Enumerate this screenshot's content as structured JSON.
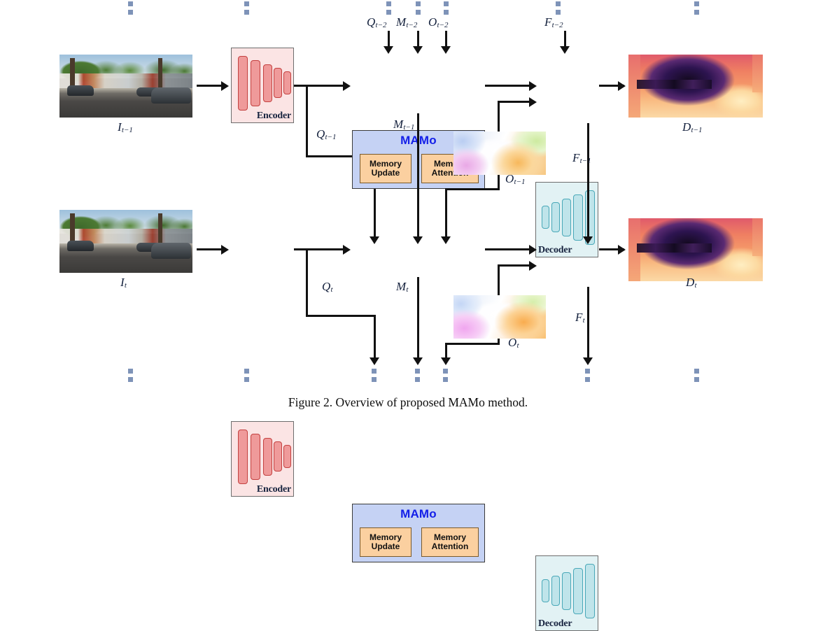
{
  "figure": {
    "caption": "Figure 2. Overview of proposed MAMo method."
  },
  "blocks": {
    "encoder_label": "Encoder",
    "decoder_label": "Decoder",
    "mamo_title": "MAMo",
    "memory_update_line1": "Memory",
    "memory_update_line2": "Update",
    "memory_attention_line1": "Memory",
    "memory_attention_line2": "Attention"
  },
  "labels": {
    "top_q": "Q",
    "top_q_sub": "t−2",
    "top_m": "M",
    "top_m_sub": "t−2",
    "top_o": "O",
    "top_o_sub": "t−2",
    "top_f": "F",
    "top_f_sub": "t−2",
    "img_prev": "I",
    "img_prev_sub": "t−1",
    "img_cur": "I",
    "img_cur_sub": "t",
    "depth_prev": "D",
    "depth_prev_sub": "t−1",
    "depth_cur": "D",
    "depth_cur_sub": "t",
    "q_prev": "Q",
    "q_prev_sub": "t−1",
    "m_prev": "M",
    "m_prev_sub": "t−1",
    "o_prev": "O",
    "o_prev_sub": "t−1",
    "f_prev": "F",
    "f_prev_sub": "t−1",
    "q_cur": "Q",
    "q_cur_sub": "t",
    "m_cur": "M",
    "m_cur_sub": "t",
    "o_cur": "O",
    "o_cur_sub": "t",
    "f_cur": "F",
    "f_cur_sub": "t"
  },
  "colors": {
    "mamo_fill": "#c5d2f4",
    "mamo_title": "#1420e8",
    "submodule_fill": "#fbd0a0",
    "encoder_fill": "#fbe4e4",
    "encoder_bar": "#ef9a9a",
    "decoder_fill": "#e2f2f4",
    "decoder_bar": "#bfe4ea",
    "line": "#111111",
    "dots": "#7e93b8",
    "label_text": "#14213d"
  }
}
